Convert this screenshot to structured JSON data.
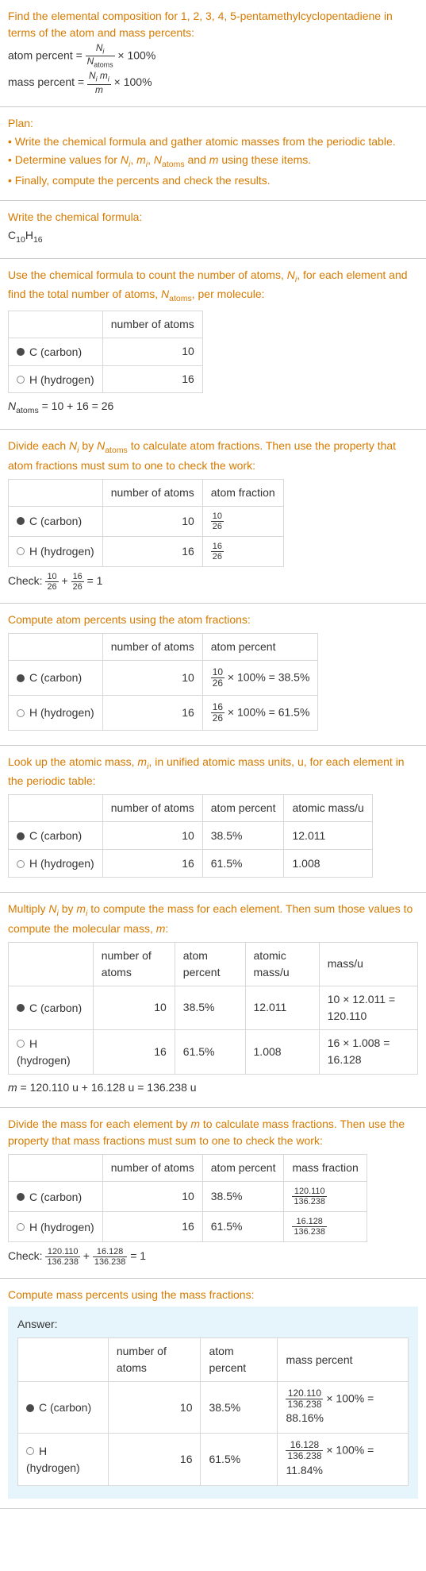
{
  "intro": {
    "line1": "Find the elemental composition for 1, 2, 3, 4, 5-pentamethylcyclopentadiene in terms of the atom and mass percents:",
    "atom_line": "atom percent = ",
    "mass_line": "mass percent = ",
    "times100a": " × 100%",
    "times100b": " × 100%",
    "frac_atom_num": "N_i",
    "frac_atom_den": "N_atoms",
    "frac_mass_num": "N_i m_i",
    "frac_mass_den": "m"
  },
  "plan": {
    "heading": "Plan:",
    "b1": "• Write the chemical formula and gather atomic masses from the periodic table.",
    "b2_a": "• Determine values for ",
    "b2_b": " and ",
    "b2_c": " using these items.",
    "b3": "• Finally, compute the percents and check the results."
  },
  "plan_vars": {
    "ni": "N_i",
    "mi": "m_i",
    "natoms": "N_atoms",
    "m": "m"
  },
  "formula_sec": {
    "heading": "Write the chemical formula:",
    "formula_c": "C",
    "formula_c_sub": "10",
    "formula_h": "H",
    "formula_h_sub": "16"
  },
  "count_sec": {
    "text_a": "Use the chemical formula to count the number of atoms, ",
    "text_b": ", for each element and find the total number of atoms, ",
    "text_c": ", per molecule:",
    "ni": "N_i",
    "natoms": "N_atoms"
  },
  "headers": {
    "natoms": "number of atoms",
    "atom_frac": "atom fraction",
    "atom_pct": "atom percent",
    "atomic_mass": "atomic mass/u",
    "mass_u": "mass/u",
    "mass_frac": "mass fraction",
    "mass_pct": "mass percent"
  },
  "elements": {
    "c_label": "C (carbon)",
    "h_label": "H (hydrogen)"
  },
  "count_table": {
    "c_atoms": "10",
    "h_atoms": "16"
  },
  "count_total": {
    "lhs": "N_atoms",
    "eq": " = 10 + 16 = 26"
  },
  "frac_sec": {
    "text_a": "Divide each ",
    "text_b": " by ",
    "text_c": " to calculate atom fractions. Then use the property that atom fractions must sum to one to check the work:",
    "ni": "N_i",
    "natoms": "N_atoms"
  },
  "frac_table": {
    "c_atoms": "10",
    "h_atoms": "16",
    "c_num": "10",
    "c_den": "26",
    "h_num": "16",
    "h_den": "26"
  },
  "frac_check": {
    "label": "Check: ",
    "n1": "10",
    "d1": "26",
    "plus": " + ",
    "n2": "16",
    "d2": "26",
    "eq": " = 1"
  },
  "pct_sec": {
    "heading": "Compute atom percents using the atom fractions:"
  },
  "pct_table": {
    "c_atoms": "10",
    "h_atoms": "16",
    "c_num": "10",
    "c_den": "26",
    "c_tail": " × 100% = 38.5%",
    "h_num": "16",
    "h_den": "26",
    "h_tail": " × 100% = 61.5%"
  },
  "mass_lookup": {
    "text_a": "Look up the atomic mass, ",
    "text_b": ", in unified atomic mass units, u, for each element in the periodic table:",
    "mi": "m_i"
  },
  "mass_lookup_table": {
    "c_atoms": "10",
    "c_pct": "38.5%",
    "c_mass": "12.011",
    "h_atoms": "16",
    "h_pct": "61.5%",
    "h_mass": "1.008"
  },
  "mult_sec": {
    "text_a": "Multiply ",
    "text_b": " by ",
    "text_c": " to compute the mass for each element. Then sum those values to compute the molecular mass, ",
    "text_d": ":",
    "ni": "N_i",
    "mi": "m_i",
    "m": "m"
  },
  "mult_table": {
    "c_atoms": "10",
    "c_pct": "38.5%",
    "c_am": "12.011",
    "c_mass": "10 × 12.011 = 120.110",
    "h_atoms": "16",
    "h_pct": "61.5%",
    "h_am": "1.008",
    "h_mass": "16 × 1.008 = 16.128"
  },
  "mult_total": {
    "lhs": "m",
    "eq": " = 120.110 u + 16.128 u = 136.238 u"
  },
  "massfrac_sec": {
    "text_a": "Divide the mass for each element by ",
    "text_b": " to calculate mass fractions. Then use the property that mass fractions must sum to one to check the work:",
    "m": "m"
  },
  "massfrac_table": {
    "c_atoms": "10",
    "c_pct": "38.5%",
    "c_num": "120.110",
    "c_den": "136.238",
    "h_atoms": "16",
    "h_pct": "61.5%",
    "h_num": "16.128",
    "h_den": "136.238"
  },
  "massfrac_check": {
    "label": "Check: ",
    "n1": "120.110",
    "d1": "136.238",
    "plus": " + ",
    "n2": "16.128",
    "d2": "136.238",
    "eq": " = 1"
  },
  "masspct_sec": {
    "heading": "Compute mass percents using the mass fractions:"
  },
  "answer": {
    "label": "Answer:"
  },
  "answer_table": {
    "c_atoms": "10",
    "c_pct": "38.5%",
    "c_num": "120.110",
    "c_den": "136.238",
    "c_tail": " × 100% = 88.16%",
    "h_atoms": "16",
    "h_pct": "61.5%",
    "h_num": "16.128",
    "h_den": "136.238",
    "h_tail": " × 100% = 11.84%"
  },
  "chart_data": {
    "type": "table",
    "title": "Elemental composition of 1,2,3,4,5-pentamethylcyclopentadiene (C10H16)",
    "elements": [
      {
        "element": "C (carbon)",
        "atoms": 10,
        "atom_fraction": 0.3846,
        "atom_percent": 38.5,
        "atomic_mass_u": 12.011,
        "mass_u": 120.11,
        "mass_fraction": 0.8816,
        "mass_percent": 88.16
      },
      {
        "element": "H (hydrogen)",
        "atoms": 16,
        "atom_fraction": 0.6154,
        "atom_percent": 61.5,
        "atomic_mass_u": 1.008,
        "mass_u": 16.128,
        "mass_fraction": 0.1184,
        "mass_percent": 11.84
      }
    ],
    "totals": {
      "N_atoms": 26,
      "molecular_mass_u": 136.238
    }
  }
}
